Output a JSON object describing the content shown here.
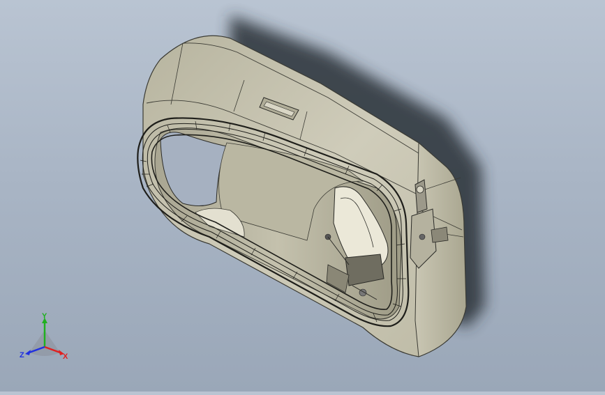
{
  "viewport": {
    "background_top": "#b9c4d2",
    "background_bottom": "#9aa7b8",
    "model_color": "#c8c6b4",
    "edge_color": "#2a2a26"
  },
  "triad": {
    "x_label": "X",
    "y_label": "Y",
    "z_label": "Z",
    "x_color": "#e02020",
    "y_color": "#20b020",
    "z_color": "#2030e0"
  }
}
